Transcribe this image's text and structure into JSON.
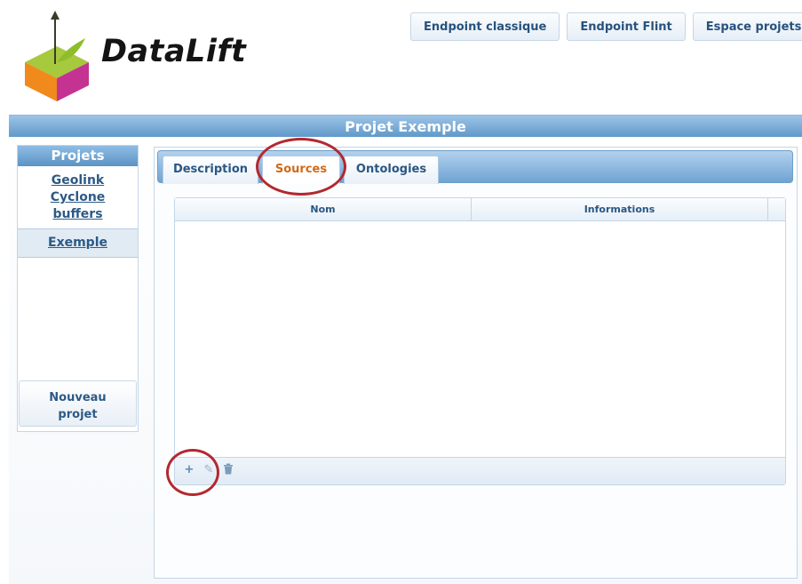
{
  "brand": {
    "name": "DataLift"
  },
  "top_nav": [
    {
      "label": "Endpoint classique"
    },
    {
      "label": "Endpoint Flint"
    },
    {
      "label": "Espace projets"
    }
  ],
  "page_title": "Projet Exemple",
  "sidebar": {
    "heading": "Projets",
    "projects": [
      {
        "label": "Geolink Cyclone buffers"
      },
      {
        "label": "Exemple",
        "selected": true
      }
    ],
    "new_project_label": "Nouveau projet"
  },
  "tabs": [
    {
      "label": "Description"
    },
    {
      "label": "Sources",
      "active": true
    },
    {
      "label": "Ontologies"
    }
  ],
  "grid": {
    "columns": [
      "Nom",
      "Informations"
    ],
    "rows": [],
    "toolbar": [
      {
        "icon": "plus-icon",
        "glyph": "+"
      },
      {
        "icon": "pencil-icon",
        "glyph": "✎"
      },
      {
        "icon": "trash-icon",
        "glyph": "🗑"
      }
    ]
  },
  "colors": {
    "accent": "#5e97c8",
    "active_tab": "#d06a18",
    "annotation": "#b3282f",
    "link": "#2c5a86"
  }
}
